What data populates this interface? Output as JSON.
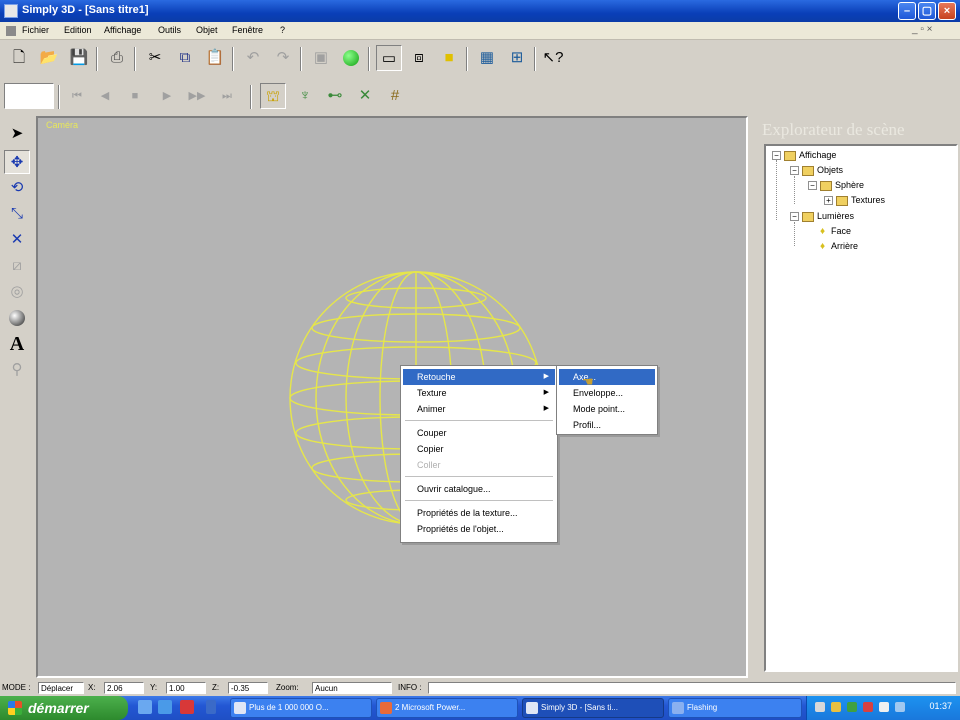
{
  "window": {
    "title": "Simply 3D - [Sans titre1]",
    "minimize_icon": "minimize-icon",
    "maximize_icon": "maximize-icon",
    "close_icon": "close-icon"
  },
  "menubar": {
    "items": [
      "Fichier",
      "Edition",
      "Affichage",
      "Outils",
      "Objet",
      "Fenêtre",
      "?"
    ],
    "mdi_controls": "_ ▫ ×"
  },
  "toolbar1": {
    "icons": [
      "new-document-icon",
      "open-folder-icon",
      "save-icon",
      "print-icon",
      "cut-icon",
      "copy-icon",
      "paste-icon",
      "undo-icon",
      "redo-icon",
      "delete-object-icon",
      "render-sphere-icon",
      "single-view-icon",
      "multi-view-icon",
      "yellow-cube-icon",
      "grid-view-icon",
      "layout-view-icon",
      "help-pointer-icon"
    ]
  },
  "toolbar2": {
    "icons": [
      "first-frame-icon",
      "previous-frame-icon",
      "stop-icon",
      "play-icon",
      "next-frame-icon",
      "last-frame-icon",
      "camera-tripod-icon",
      "lamp-icon",
      "link-object-icon",
      "scale-object-icon",
      "animation-grid-icon"
    ]
  },
  "palette": {
    "icons": [
      "select-arrow-icon",
      "move-icon",
      "rotate-icon",
      "scale-icon",
      "stretch-icon",
      "shear-icon",
      "circle-icon",
      "sphere-shape-icon",
      "text-tool-icon",
      "magnify-icon"
    ]
  },
  "viewport": {
    "label": "Caméra"
  },
  "context_menu": {
    "items": [
      "Retouche",
      "Texture",
      "Animer",
      "Couper",
      "Copier",
      "Coller",
      "Ouvrir catalogue...",
      "Propriétés de la texture...",
      "Propriétés de l'objet..."
    ],
    "disabled": [
      "Coller"
    ],
    "highlighted": "Retouche"
  },
  "submenu": {
    "items": [
      "Axe...",
      "Enveloppe...",
      "Mode point...",
      "Profil..."
    ],
    "highlighted": "Axe..."
  },
  "explorer": {
    "title": "Explorateur de scène",
    "tree": [
      "Affichage",
      "Objets",
      "Sphère",
      "Textures",
      "Lumières",
      "Face",
      "Arrière"
    ]
  },
  "statusbar": {
    "mode_label": "MODE :",
    "mode_value": "Déplacer",
    "x_label": "X:",
    "x_value": "2.06",
    "y_label": "Y:",
    "y_value": "1.00",
    "z_label": "Z:",
    "z_value": "-0.35",
    "zoom_label": "Zoom:",
    "zoom_value": "Aucun",
    "info_label": "INFO :",
    "info_value": ""
  },
  "taskbar": {
    "start_label": "démarrer",
    "tasks": [
      "Plus de 1 000 000 O...",
      "2 Microsoft Power...",
      "Simply 3D - [Sans ti...",
      "Flashing"
    ],
    "active_task": "Simply 3D - [Sans ti...",
    "clock": "01:37"
  },
  "colors": {
    "wireframe": "#e6e64a",
    "highlight": "#316ac5",
    "viewport_bg": "#b4b4b4"
  }
}
